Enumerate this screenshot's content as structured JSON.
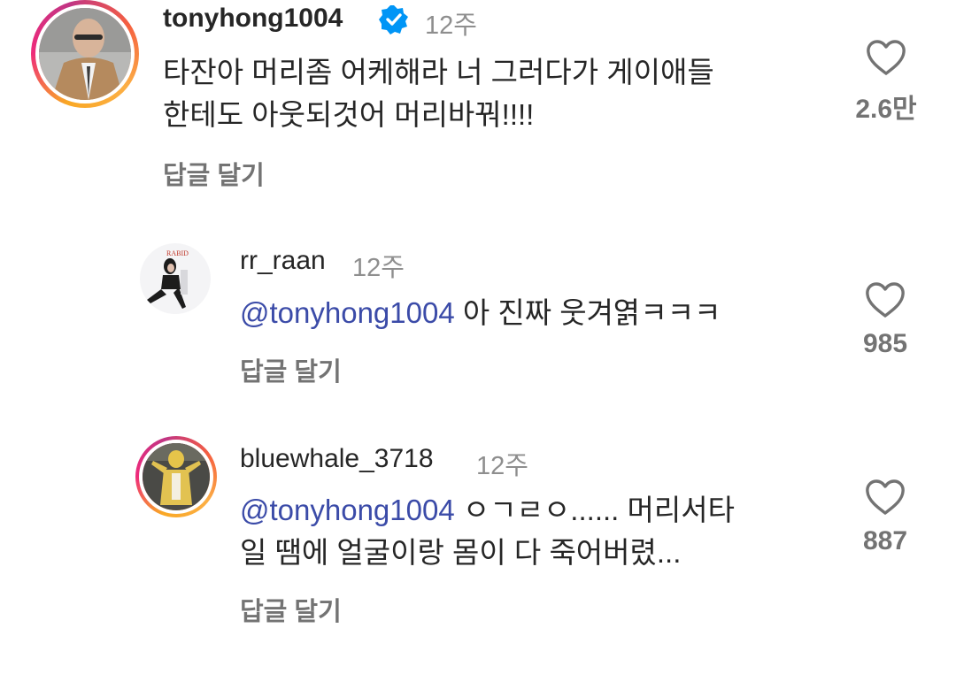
{
  "comments": [
    {
      "username": "tonyhong1004",
      "verified": true,
      "time": "12주",
      "text_lines": [
        "타잔아 머리좀 어케해라  너 그러다가 게이애들",
        "한테도 아웃되것어  머리바꿔!!!!"
      ],
      "reply_label": "답글 달기",
      "likes": "2.6만"
    },
    {
      "username": "rr_raan",
      "time": "12주",
      "mention": "@tonyhong1004",
      "text_lines": [
        " 아 진짜 웃겨엵ㅋㅋㅋ"
      ],
      "reply_label": "답글 달기",
      "likes": "985"
    },
    {
      "username": "bluewhale_3718",
      "time": "12주",
      "mention": "@tonyhong1004",
      "text_lines": [
        " ㅇㄱㄹㅇ...... 머리서타",
        "일 땜에 얼굴이랑 몸이 다 죽어버렸..."
      ],
      "reply_label": "답글 달기",
      "likes": "887"
    }
  ],
  "icons": {
    "heart": "heart-outline-icon",
    "verified": "verified-badge-icon"
  },
  "colors": {
    "mention": "#3b4ba8",
    "verified": "#0095f6",
    "secondary_text": "#737373"
  }
}
